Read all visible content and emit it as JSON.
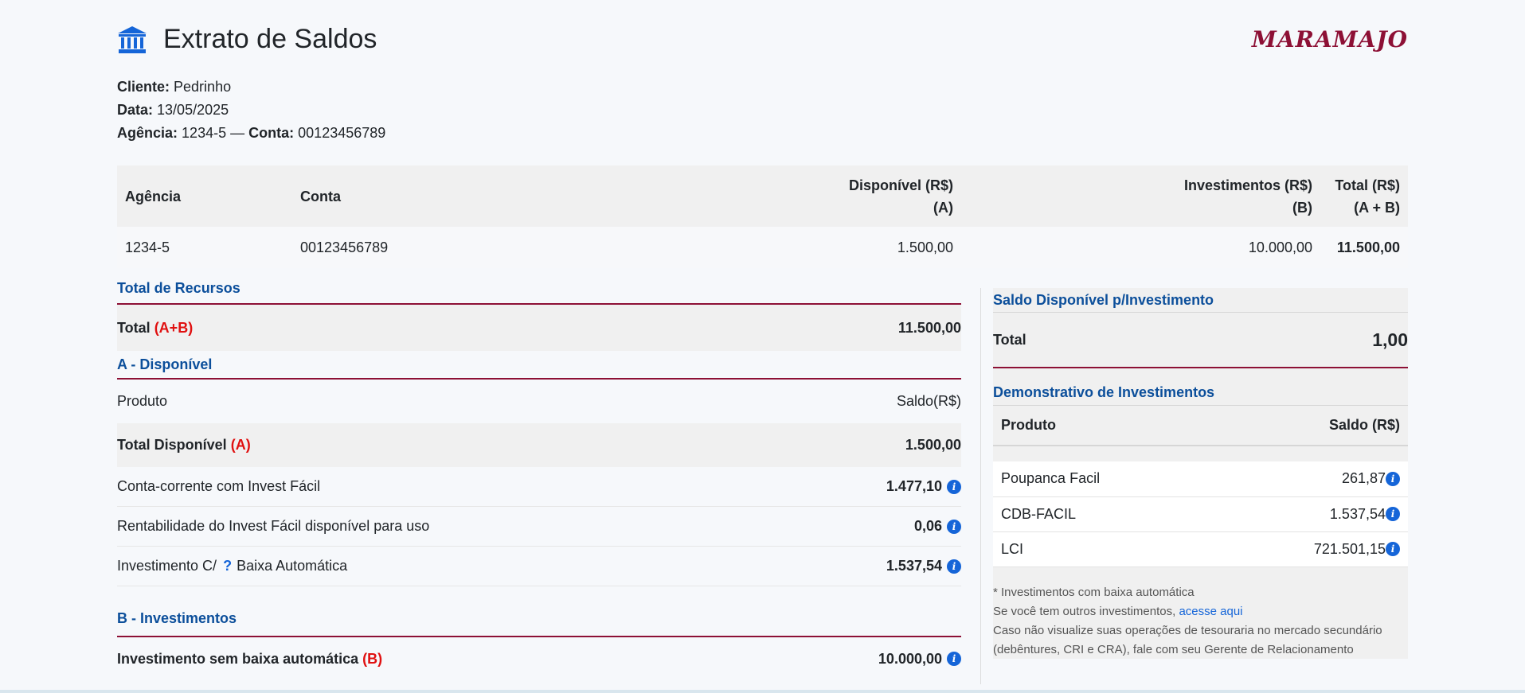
{
  "header": {
    "title": "Extrato de Saldos",
    "icon": "bank-icon",
    "logo": "MARAMAJO",
    "logo_color": "#8d1035"
  },
  "client": {
    "client_label": "Cliente:",
    "client_name": "Pedrinho",
    "date_label": "Data:",
    "date": "13/05/2025",
    "agency_label": "Agência:",
    "agency": "1234-5",
    "separator": "—",
    "account_label": "Conta:",
    "account": "00123456789"
  },
  "summary": {
    "headers": {
      "agency": "Agência",
      "account": "Conta",
      "available_1": "Disponível (R$)",
      "available_2": "(A)",
      "investments_1": "Investimentos (R$)",
      "investments_2": "(B)",
      "total_1": "Total (R$)",
      "total_2": "(A + B)"
    },
    "row": {
      "agency": "1234-5",
      "account": "00123456789",
      "available": "1.500,00",
      "investments": "10.000,00",
      "total": "11.500,00"
    }
  },
  "resources": {
    "title": "Total de Recursos",
    "total_label": "Total",
    "total_tag": "(A+B)",
    "total_value": "11.500,00"
  },
  "available": {
    "title": "A - Disponível",
    "product_header": "Produto",
    "balance_header": "Saldo(R$)",
    "total_label": "Total Disponível",
    "total_tag": "(A)",
    "total_value": "1.500,00",
    "items": [
      {
        "label": "Conta-corrente com Invest Fácil",
        "value": "1.477,10"
      },
      {
        "label": "Rentabilidade do Invest Fácil disponível para uso",
        "value": "0,06"
      },
      {
        "label_pre": "Investimento C/",
        "label_post": "Baixa Automática",
        "value": "1.537,54"
      }
    ],
    "question_mark": "?"
  },
  "investments": {
    "title": "B - Investimentos",
    "label": "Investimento sem baixa automática",
    "tag": "(B)",
    "value": "10.000,00"
  },
  "right": {
    "available_title": "Saldo Disponível p/Investimento",
    "total_label": "Total",
    "total_value": "1,00",
    "demo_title": "Demonstrativo de Investimentos",
    "product_header": "Produto",
    "balance_header": "Saldo (R$)",
    "items": [
      {
        "product": "Poupanca Facil",
        "value": "261,87"
      },
      {
        "product": "CDB-FACIL",
        "value": "1.537,54"
      },
      {
        "product": "LCI",
        "value": "721.501,15"
      }
    ],
    "note1": "* Investimentos com baixa automática",
    "note2_pre": "Se você tem outros investimentos,",
    "note2_link": "acesse aqui",
    "note3": "Caso não visualize suas operações de tesouraria no mercado secundário",
    "note4": "(debêntures, CRI e CRA), fale com seu Gerente de Relacionamento"
  },
  "info_glyph": "i",
  "colors": {
    "accent_blue": "#0c4f9b",
    "info_blue": "#1565d8",
    "divider_red": "#8d1035",
    "tag_red": "#e01010"
  }
}
